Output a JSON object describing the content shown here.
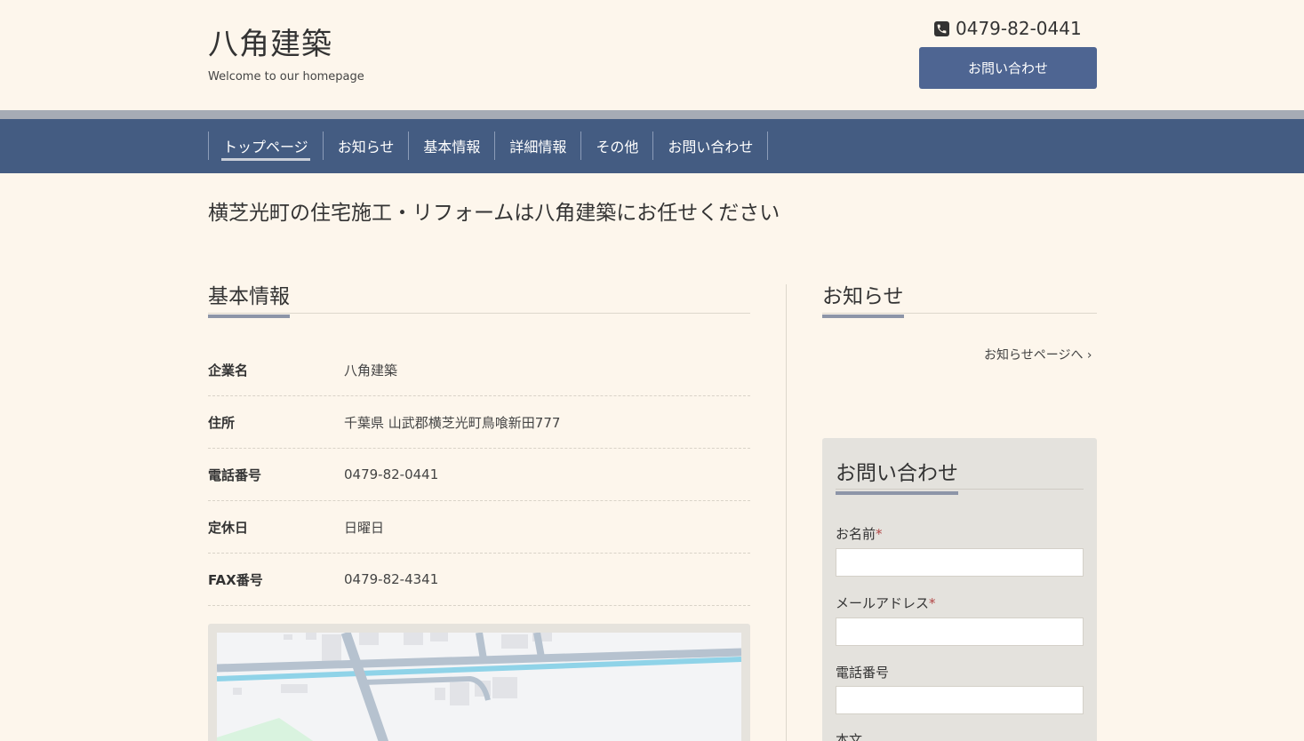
{
  "header": {
    "site_title": "八角建築",
    "tagline": "Welcome to our homepage",
    "phone": "0479-82-0441",
    "contact_button": "お問い合わせ"
  },
  "nav": {
    "items": [
      "トップページ",
      "お知らせ",
      "基本情報",
      "詳細情報",
      "その他",
      "お問い合わせ"
    ],
    "active_index": 0
  },
  "catch_copy": "横芝光町の住宅施工・リフォームは八角建築にお任せください",
  "basic_info": {
    "title": "基本情報",
    "rows": [
      {
        "key": "企業名",
        "value": "八角建築"
      },
      {
        "key": "住所",
        "value": "千葉県 山武郡横芝光町鳥喰新田777"
      },
      {
        "key": "電話番号",
        "value": "0479-82-0441"
      },
      {
        "key": "定休日",
        "value": "日曜日"
      },
      {
        "key": "FAX番号",
        "value": "0479-82-4341"
      }
    ]
  },
  "news": {
    "title": "お知らせ",
    "link": "お知らせページへ ›"
  },
  "contact_form": {
    "title": "お問い合わせ",
    "fields": [
      {
        "label": "お名前",
        "required": "*"
      },
      {
        "label": "メールアドレス",
        "required": "*"
      },
      {
        "label": "電話番号",
        "required": ""
      },
      {
        "label": "本文",
        "required": ""
      }
    ]
  },
  "colors": {
    "background": "#fdf6ec",
    "nav": "#445c82",
    "button": "#4e6592",
    "underline": "#8d95a8"
  }
}
